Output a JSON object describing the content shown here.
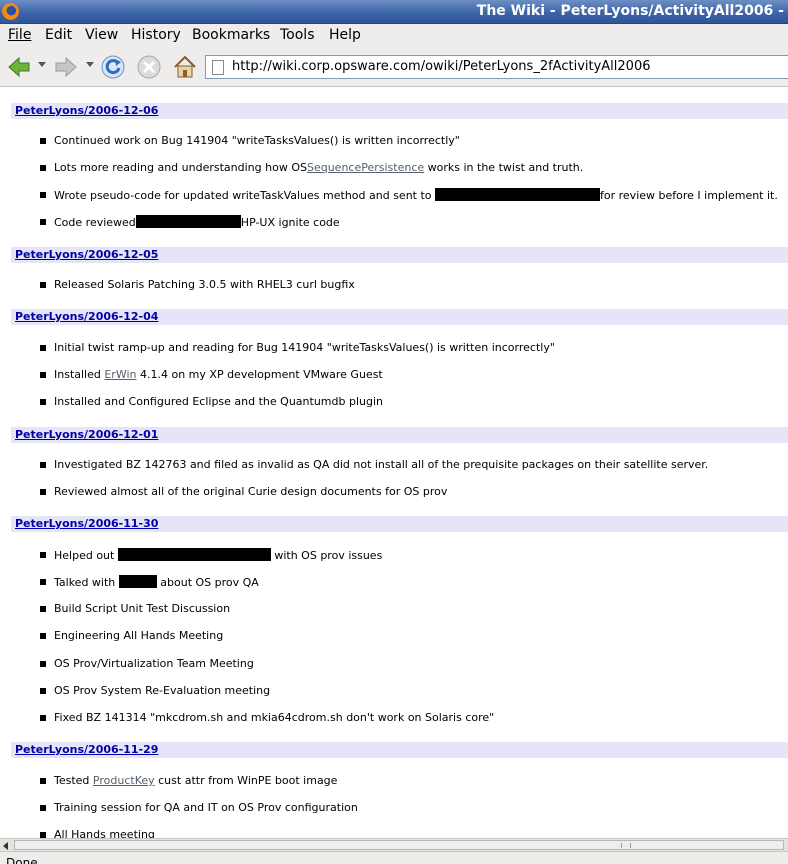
{
  "window": {
    "title": "The Wiki - PeterLyons/ActivityAll2006 -"
  },
  "menu": [
    "File",
    "Edit",
    "View",
    "History",
    "Bookmarks",
    "Tools",
    "Help"
  ],
  "toolbar": {
    "url": "http://wiki.corp.opsware.com/owiki/PeterLyons_2fActivityAll2006",
    "icons": [
      "back-icon",
      "forward-icon",
      "reload-icon",
      "stop-icon",
      "home-icon",
      "page-icon"
    ]
  },
  "sections": [
    {
      "heading": "PeterLyons/2006-12-06",
      "items": [
        {
          "parts": [
            "Continued work on Bug 141904 \"writeTasksValues() is written incorrectly\""
          ]
        },
        {
          "parts": [
            "Lots more reading and understanding how OS",
            "SequencePersistence",
            " works in the twist and truth."
          ]
        },
        {
          "parts": [
            "Wrote pseudo-code for updated writeTaskValues method and sent to ",
            "",
            "for review before I implement it."
          ]
        },
        {
          "parts": [
            "Code reviewed",
            "",
            "HP-UX ignite code"
          ]
        }
      ]
    },
    {
      "heading": "PeterLyons/2006-12-05",
      "items": [
        {
          "parts": [
            "Released Solaris Patching 3.0.5 with RHEL3 curl bugfix"
          ]
        }
      ]
    },
    {
      "heading": "PeterLyons/2006-12-04",
      "items": [
        {
          "parts": [
            "Initial twist ramp-up and reading for Bug 141904 \"writeTasksValues() is written incorrectly\""
          ]
        },
        {
          "parts": [
            "Installed ",
            "ErWin",
            " 4.1.4 on my XP development VMware Guest"
          ]
        },
        {
          "parts": [
            "Installed and Configured Eclipse and the Quantumdb plugin"
          ]
        }
      ]
    },
    {
      "heading": "PeterLyons/2006-12-01",
      "items": [
        {
          "parts": [
            "Investigated BZ 142763 and filed as invalid as QA did not install all of the prequisite packages on their satellite server."
          ]
        },
        {
          "parts": [
            "Reviewed almost all of the original Curie design documents for OS prov"
          ]
        }
      ]
    },
    {
      "heading": "PeterLyons/2006-11-30",
      "items": [
        {
          "parts": [
            "Helped out ",
            "",
            "with OS prov issues"
          ]
        },
        {
          "parts": [
            "Talked with ",
            "",
            "about OS prov QA"
          ]
        },
        {
          "parts": [
            "Build Script Unit Test Discussion"
          ]
        },
        {
          "parts": [
            "Engineering All Hands Meeting"
          ]
        },
        {
          "parts": [
            "OS Prov/Virtualization Team Meeting"
          ]
        },
        {
          "parts": [
            "OS Prov System Re-Evaluation meeting"
          ]
        },
        {
          "parts": [
            "Fixed BZ 141314 \"mkcdrom.sh and mkia64cdrom.sh don't work on Solaris core\""
          ]
        }
      ]
    },
    {
      "heading": "PeterLyons/2006-11-29",
      "items": [
        {
          "parts": [
            "Tested ",
            "ProductKey",
            " cust attr from WinPE boot image"
          ]
        },
        {
          "parts": [
            "Training session for QA and IT on OS Prov configuration"
          ]
        },
        {
          "parts": [
            "All Hands meeting"
          ]
        }
      ]
    }
  ],
  "status": {
    "text": "Done"
  }
}
